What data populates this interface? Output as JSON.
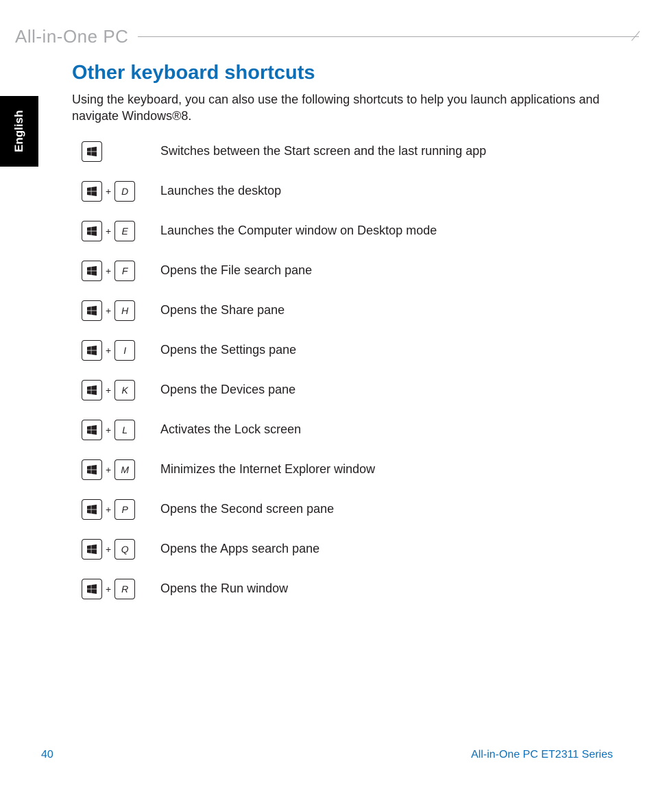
{
  "header": {
    "product": "All-in-One PC"
  },
  "language_tab": "English",
  "section": {
    "heading": "Other keyboard shortcuts",
    "intro": "Using the keyboard, you can also use the following shortcuts to help you launch applications and navigate Windows®8."
  },
  "shortcuts": [
    {
      "key2": null,
      "desc": "Switches between the Start screen and the last running app"
    },
    {
      "key2": "D",
      "desc": "Launches the desktop"
    },
    {
      "key2": "E",
      "desc": "Launches the Computer window on Desktop mode"
    },
    {
      "key2": "F",
      "desc": "Opens the File search pane"
    },
    {
      "key2": "H",
      "desc": "Opens the Share pane"
    },
    {
      "key2": "I",
      "desc": "Opens the Settings pane"
    },
    {
      "key2": "K",
      "desc": "Opens the Devices pane"
    },
    {
      "key2": "L",
      "desc": "Activates the Lock screen"
    },
    {
      "key2": "M",
      "desc": "Minimizes the Internet Explorer window"
    },
    {
      "key2": "P",
      "desc": "Opens the Second screen pane"
    },
    {
      "key2": "Q",
      "desc": "Opens the Apps search pane"
    },
    {
      "key2": "R",
      "desc": "Opens the Run window"
    }
  ],
  "plus": "+",
  "footer": {
    "page": "40",
    "series": "All-in-One PC ET2311 Series"
  }
}
